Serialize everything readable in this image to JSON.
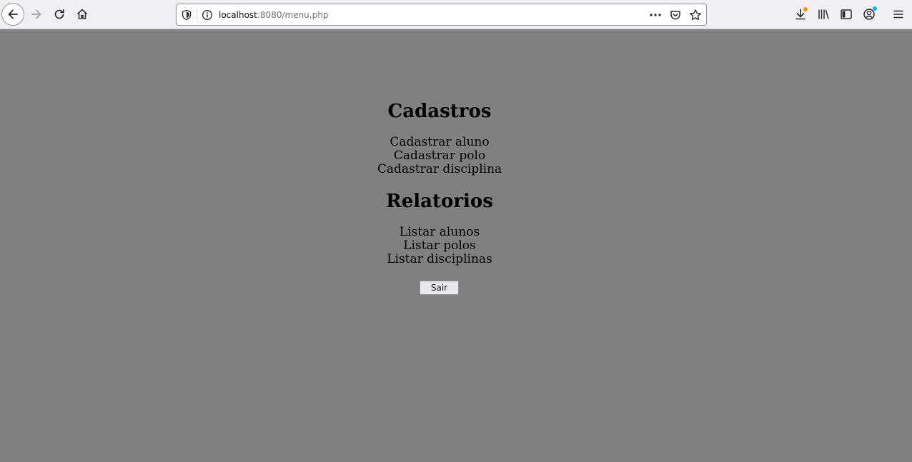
{
  "browser": {
    "url_host": "localhost",
    "url_rest": ":8080/menu.php",
    "icons": [
      "back-arrow-icon",
      "forward-arrow-icon",
      "reload-icon",
      "home-icon",
      "shield-icon",
      "info-icon",
      "more-dots-icon",
      "pocket-icon",
      "bookmark-star-icon",
      "download-icon",
      "library-icon",
      "sidebar-icon",
      "account-icon",
      "hamburger-menu-icon"
    ],
    "download_badge_color": "#ff9400",
    "account_badge_color": "#00b3f4"
  },
  "page": {
    "background": "#808080",
    "cadastros": {
      "title": "Cadastros",
      "links": [
        "Cadastrar aluno",
        "Cadastrar polo",
        "Cadastrar disciplina"
      ]
    },
    "relatorios": {
      "title": "Relatorios",
      "links": [
        "Listar alunos",
        "Listar polos",
        "Listar disciplinas"
      ]
    },
    "logout_label": "Sair"
  }
}
